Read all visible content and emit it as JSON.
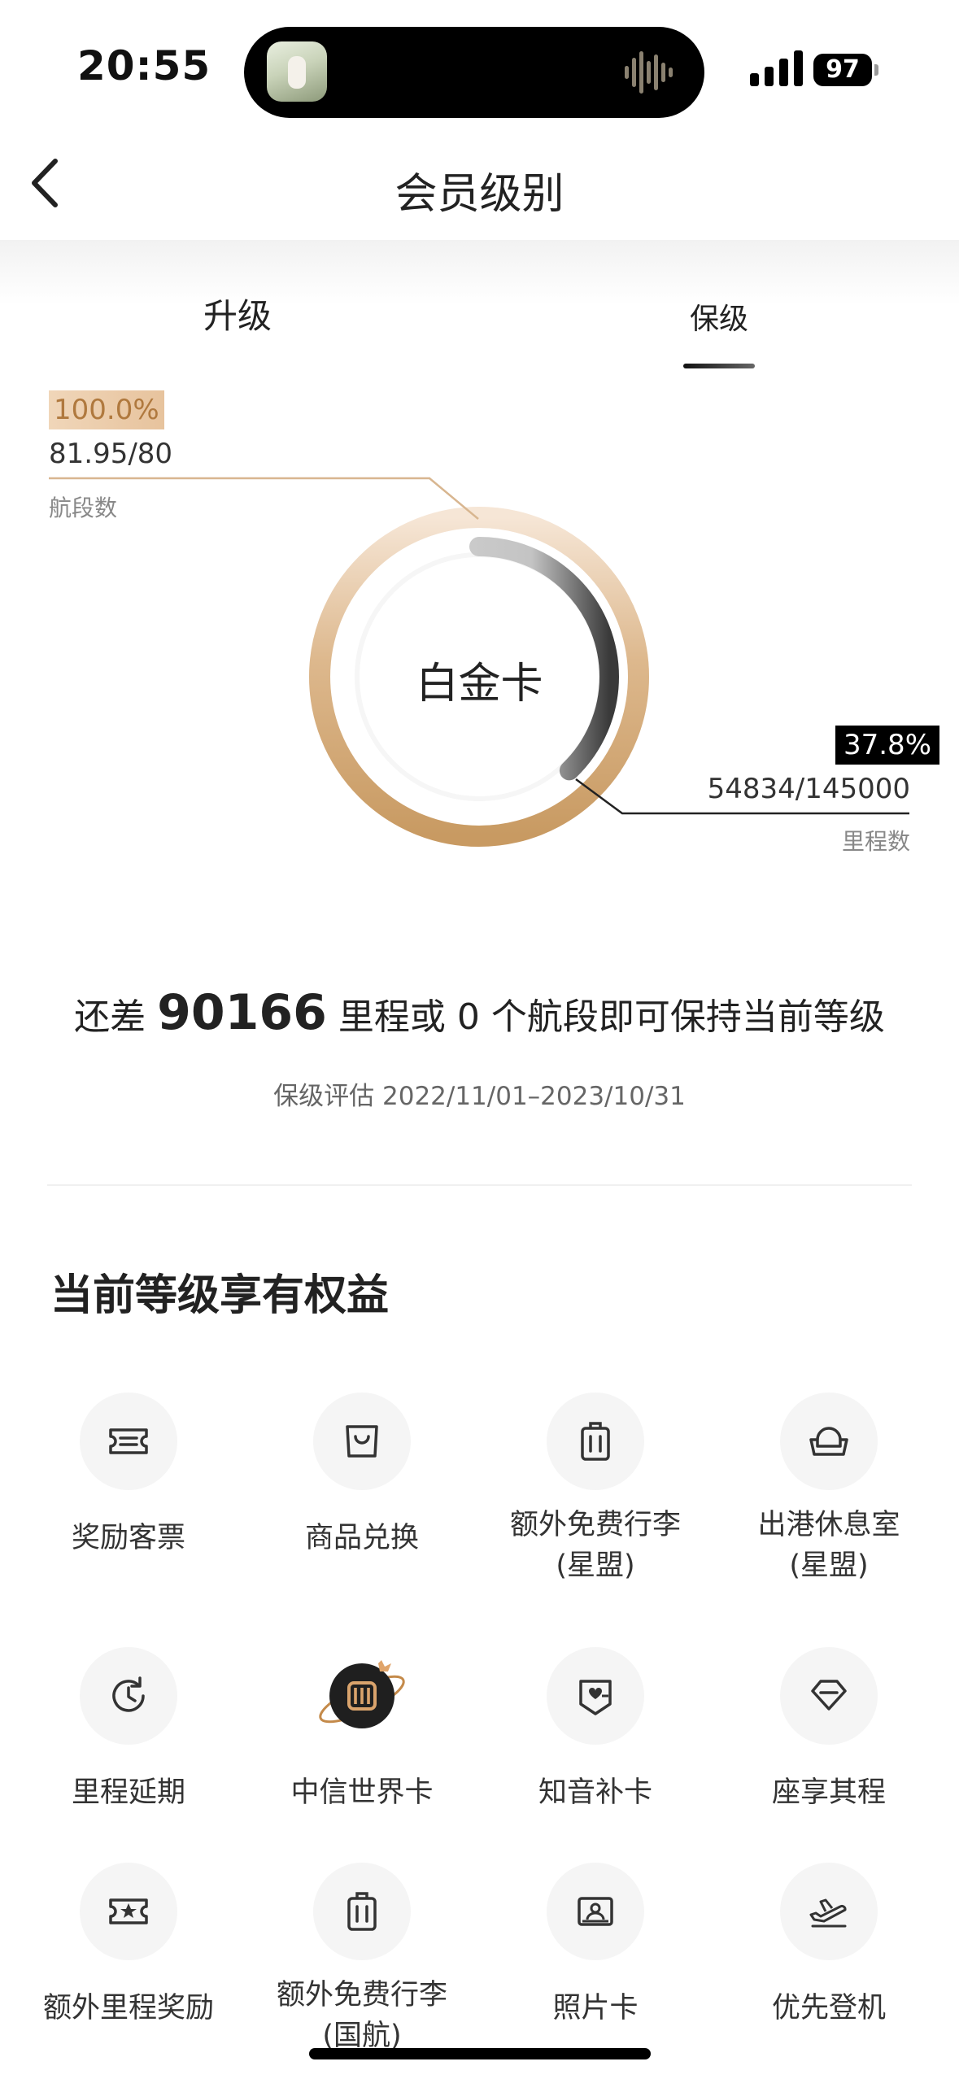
{
  "status_bar": {
    "time": "20:55",
    "battery": "97"
  },
  "header": {
    "title": "会员级别"
  },
  "tabs": [
    {
      "label": "升级"
    },
    {
      "label": "保级"
    }
  ],
  "progress": {
    "segments": {
      "percent_text": "100.0%",
      "value_text": "81.95/80",
      "label": "航段数",
      "fraction": 1.0
    },
    "miles": {
      "percent_text": "37.8%",
      "value_text": "54834/145000",
      "label": "里程数",
      "fraction": 0.378
    },
    "center_label": "白金卡"
  },
  "remain": {
    "prefix": "还差",
    "miles": "90166",
    "middle": "里程或",
    "segments": "0",
    "suffix": "个航段即可保持当前等级"
  },
  "evaluation": "保级评估 2022/11/01–2023/10/31",
  "benefits_title": "当前等级享有权益",
  "benefits": [
    {
      "label": "奖励客票",
      "icon": "ticket-icon"
    },
    {
      "label": "商品兑换",
      "icon": "shopping-bag-icon"
    },
    {
      "label": "额外免费行李\n(星盟)",
      "icon": "luggage-icon"
    },
    {
      "label": "出港休息室\n(星盟)",
      "icon": "lounge-sofa-icon"
    },
    {
      "label": "里程延期",
      "icon": "clock-refresh-icon"
    },
    {
      "label": "中信世界卡",
      "icon": "citic-card-icon"
    },
    {
      "label": "知音补卡",
      "icon": "card-plus-icon"
    },
    {
      "label": "座享其程",
      "icon": "diamond-seat-icon"
    },
    {
      "label": "额外里程奖励",
      "icon": "star-ticket-icon"
    },
    {
      "label": "额外免费行李\n(国航)",
      "icon": "luggage-icon"
    },
    {
      "label": "照片卡",
      "icon": "photo-card-icon"
    },
    {
      "label": "优先登机",
      "icon": "airplane-takeoff-icon"
    }
  ]
}
